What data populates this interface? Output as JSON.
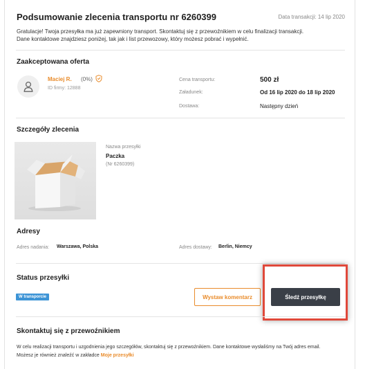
{
  "header": {
    "title": "Podsumowanie zlecenia transportu nr 6260399",
    "transaction_date": "Data transakcji: 14 lip 2020",
    "intro_line1": "Gratulacje! Twoja przesyłka ma już zapewniony transport. Skontaktuj się z przewoźnikiem w celu finalizacji transakcji.",
    "intro_line2": "Dane kontaktowe znajdziesz poniżej, tak jak i list przewozowy, który możesz pobrać i wypełnić."
  },
  "offer": {
    "heading": "Zaakceptowana oferta",
    "carrier_name": "Maciej R.",
    "rating": "(0%)",
    "firm_id": "ID firmy: 12888",
    "price_label": "Cena transportu:",
    "price_value": "500 zł",
    "loading_label": "Załadunek:",
    "loading_value": "Od 16 lip 2020 do 18 lip 2020",
    "delivery_label": "Dostawa:",
    "delivery_value": "Następny dzień"
  },
  "details": {
    "heading": "Szczegóły zlecenia",
    "shipment_name_label": "Nazwa przesyłki",
    "shipment_name": "Paczka",
    "shipment_number": "(Nr 6260399)"
  },
  "addresses": {
    "heading": "Adresy",
    "pickup_label": "Adres nadania:",
    "pickup_value": "Warszawa, Polska",
    "delivery_label": "Adres dostawy:",
    "delivery_value": "Berlin, Niemcy"
  },
  "status": {
    "heading": "Status przesyłki",
    "badge": "W transporcie",
    "comment_button": "Wystaw komentarz",
    "track_button": "Śledź przesyłkę"
  },
  "contact": {
    "heading": "Skontaktuj się z przewoźnikiem",
    "line1": "W celu realizacji transportu i uzgodnienia jego szczegółów, skontaktuj się z przewoźnikiem. Dane kontaktowe wysłaliśmy na Twój adres email.",
    "line2_prefix": "Możesz je również znaleźć w zakładce",
    "line2_link": "Moje przesyłki"
  },
  "colors": {
    "accent": "#e98b2a",
    "badge": "#3d94d6",
    "dark_button": "#3a3f47",
    "highlight": "#e0483a"
  },
  "icons": [
    "user-icon",
    "shield-check-icon",
    "package-box-image"
  ]
}
